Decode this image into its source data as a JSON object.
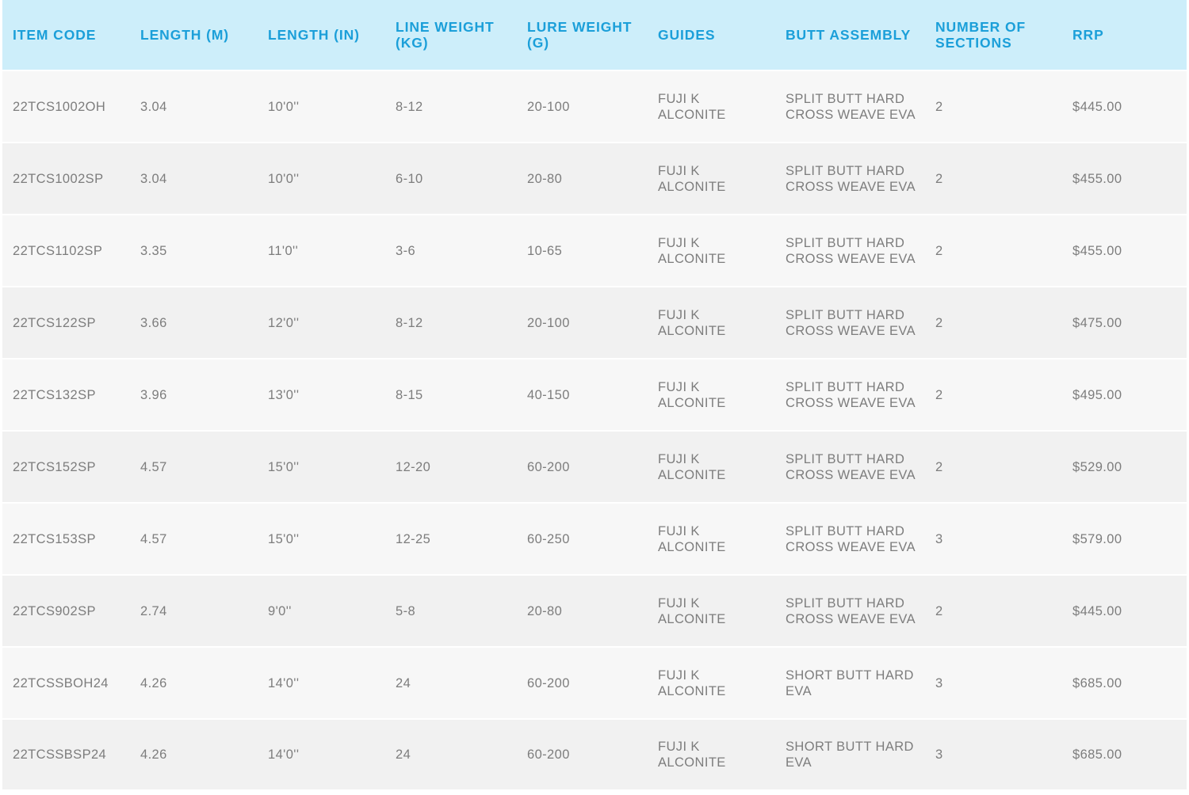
{
  "table": {
    "headers": [
      {
        "l1": "ITEM CODE",
        "l2": ""
      },
      {
        "l1": "LENGTH (M)",
        "l2": ""
      },
      {
        "l1": "LENGTH (IN)",
        "l2": ""
      },
      {
        "l1": "LINE WEIGHT",
        "l2": "(KG)"
      },
      {
        "l1": "LURE WEIGHT",
        "l2": "(G)"
      },
      {
        "l1": "GUIDES",
        "l2": ""
      },
      {
        "l1": "BUTT ASSEMBLY",
        "l2": ""
      },
      {
        "l1": "NUMBER OF",
        "l2": "SECTIONS"
      },
      {
        "l1": "RRP",
        "l2": ""
      }
    ],
    "rows": [
      {
        "item_code": "22TCS1002OH",
        "length_m": "3.04",
        "length_in": "10'0''",
        "line_weight": "8-12",
        "lure_weight": "20-100",
        "guides_1": "FUJI K",
        "guides_2": "ALCONITE",
        "butt_1": "SPLIT BUTT HARD",
        "butt_2": "CROSS WEAVE EVA",
        "sections": "2",
        "rrp": "$445.00"
      },
      {
        "item_code": "22TCS1002SP",
        "length_m": "3.04",
        "length_in": "10'0''",
        "line_weight": "6-10",
        "lure_weight": "20-80",
        "guides_1": "FUJI K",
        "guides_2": "ALCONITE",
        "butt_1": "SPLIT BUTT HARD",
        "butt_2": "CROSS WEAVE EVA",
        "sections": "2",
        "rrp": "$455.00"
      },
      {
        "item_code": "22TCS1102SP",
        "length_m": "3.35",
        "length_in": "11'0''",
        "line_weight": "3-6",
        "lure_weight": "10-65",
        "guides_1": "FUJI K",
        "guides_2": "ALCONITE",
        "butt_1": "SPLIT BUTT HARD",
        "butt_2": "CROSS WEAVE EVA",
        "sections": "2",
        "rrp": "$455.00"
      },
      {
        "item_code": "22TCS122SP",
        "length_m": "3.66",
        "length_in": "12'0''",
        "line_weight": "8-12",
        "lure_weight": "20-100",
        "guides_1": "FUJI K",
        "guides_2": "ALCONITE",
        "butt_1": "SPLIT BUTT HARD",
        "butt_2": "CROSS WEAVE EVA",
        "sections": "2",
        "rrp": "$475.00"
      },
      {
        "item_code": "22TCS132SP",
        "length_m": "3.96",
        "length_in": "13'0''",
        "line_weight": "8-15",
        "lure_weight": "40-150",
        "guides_1": "FUJI K",
        "guides_2": "ALCONITE",
        "butt_1": "SPLIT BUTT HARD",
        "butt_2": "CROSS WEAVE EVA",
        "sections": "2",
        "rrp": "$495.00"
      },
      {
        "item_code": "22TCS152SP",
        "length_m": "4.57",
        "length_in": "15'0''",
        "line_weight": "12-20",
        "lure_weight": "60-200",
        "guides_1": "FUJI K",
        "guides_2": "ALCONITE",
        "butt_1": "SPLIT BUTT HARD",
        "butt_2": "CROSS WEAVE EVA",
        "sections": "2",
        "rrp": "$529.00"
      },
      {
        "item_code": "22TCS153SP",
        "length_m": "4.57",
        "length_in": "15'0''",
        "line_weight": "12-25",
        "lure_weight": "60-250",
        "guides_1": "FUJI K",
        "guides_2": "ALCONITE",
        "butt_1": "SPLIT BUTT HARD",
        "butt_2": "CROSS WEAVE EVA",
        "sections": "3",
        "rrp": "$579.00"
      },
      {
        "item_code": "22TCS902SP",
        "length_m": "2.74",
        "length_in": "9'0''",
        "line_weight": "5-8",
        "lure_weight": "20-80",
        "guides_1": "FUJI K",
        "guides_2": "ALCONITE",
        "butt_1": "SPLIT BUTT HARD",
        "butt_2": "CROSS WEAVE EVA",
        "sections": "2",
        "rrp": "$445.00"
      },
      {
        "item_code": "22TCSSBOH24",
        "length_m": "4.26",
        "length_in": "14'0''",
        "line_weight": "24",
        "lure_weight": "60-200",
        "guides_1": "FUJI K",
        "guides_2": "ALCONITE",
        "butt_1": "SHORT BUTT HARD",
        "butt_2": "EVA",
        "sections": "3",
        "rrp": "$685.00"
      },
      {
        "item_code": "22TCSSBSP24",
        "length_m": "4.26",
        "length_in": "14'0''",
        "line_weight": "24",
        "lure_weight": "60-200",
        "guides_1": "FUJI K",
        "guides_2": "ALCONITE",
        "butt_1": "SHORT BUTT HARD",
        "butt_2": "EVA",
        "sections": "3",
        "rrp": "$685.00"
      }
    ]
  },
  "colors": {
    "header_background": "#cdeefa",
    "header_text": "#1b9fd9",
    "row_odd_background": "#f7f7f7",
    "row_even_background": "#f1f1f1",
    "cell_text": "#7d7d7d"
  }
}
